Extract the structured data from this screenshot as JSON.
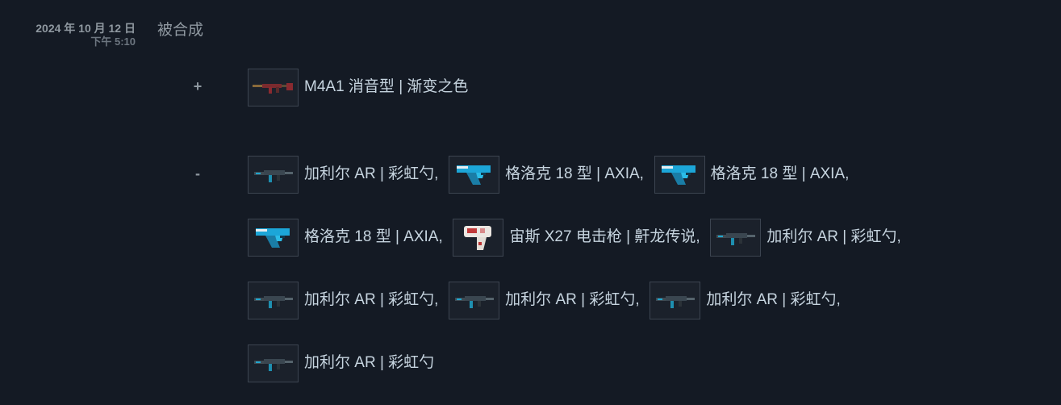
{
  "entry": {
    "date": "2024 年 10 月 12 日",
    "time": "下午 5:10",
    "action": "被合成"
  },
  "gained": {
    "sign": "+",
    "items": [
      {
        "name": "M4A1 消音型 | 渐变之色",
        "icon": "m4a1-rifle-icon"
      }
    ]
  },
  "lost": {
    "sign": "-",
    "items": [
      {
        "name": "加利尔 AR | 彩虹勺",
        "icon": "galil-rifle-icon"
      },
      {
        "name": "格洛克 18 型 | AXIA",
        "icon": "glock-pistol-icon"
      },
      {
        "name": "格洛克 18 型 | AXIA",
        "icon": "glock-pistol-icon"
      },
      {
        "name": "格洛克 18 型 | AXIA",
        "icon": "glock-pistol-icon"
      },
      {
        "name": "宙斯 X27 电击枪 | 鼾龙传说",
        "icon": "zeus-taser-icon"
      },
      {
        "name": "加利尔 AR | 彩虹勺",
        "icon": "galil-rifle-icon"
      },
      {
        "name": "加利尔 AR | 彩虹勺",
        "icon": "galil-rifle-icon"
      },
      {
        "name": "加利尔 AR | 彩虹勺",
        "icon": "galil-rifle-icon"
      },
      {
        "name": "加利尔 AR | 彩虹勺",
        "icon": "galil-rifle-icon"
      },
      {
        "name": "加利尔 AR | 彩虹勺",
        "icon": "galil-rifle-icon"
      }
    ],
    "separator": ","
  }
}
